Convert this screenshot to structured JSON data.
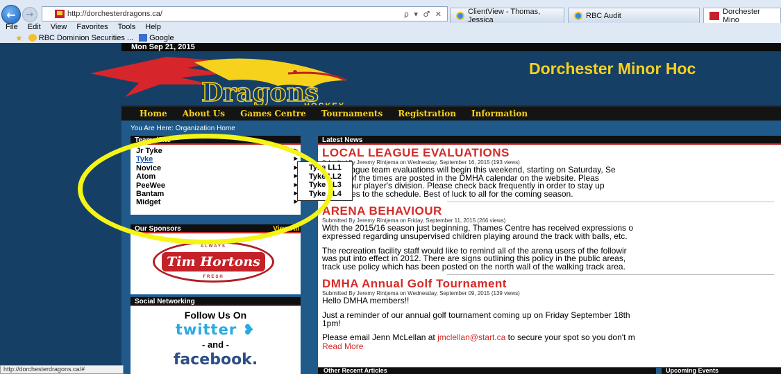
{
  "browser": {
    "url": "http://dorchesterdragons.ca/",
    "address_controls": "ρ ▾ ♂ ✕",
    "tabs": [
      {
        "label": "ClientView - Thomas, Jessica"
      },
      {
        "label": "RBC Audit"
      },
      {
        "label": "Dorchester Mino"
      }
    ],
    "menu": [
      "File",
      "Edit",
      "View",
      "Favorites",
      "Tools",
      "Help"
    ],
    "favorites": [
      "RBC Dominion Securities ...",
      "Google"
    ],
    "status_url": "http://dorchesterdragons.ca/#"
  },
  "page": {
    "date": "Mon Sep 21, 2015",
    "site_title": "Dorchester Minor Hoc",
    "logo_text": "Dragons",
    "logo_subtext": "HOCKEY",
    "nav": [
      "Home",
      "About Us",
      "Games Centre",
      "Tournaments",
      "Registration",
      "Information"
    ],
    "breadcrumb": "You Are Here: Organization Home",
    "teams": {
      "heading": "Teams/Site",
      "items": [
        "Jr Tyke",
        "Tyke",
        "Novice",
        "Atom",
        "PeeWee",
        "Bantam",
        "Midget"
      ],
      "submenu": [
        "Tyke LL1",
        "Tyke LL2",
        "Tyke LL3",
        "Tyke LL4"
      ]
    },
    "sponsors": {
      "heading": "Our Sponsors",
      "view_all": "View All",
      "sponsor_name": "Tim Hortons",
      "top_small": "ALWAYS",
      "bottom_small": "FRESH"
    },
    "social": {
      "heading": "Social Networking",
      "follow": "Follow Us On",
      "twitter": "twitter",
      "and": "- and -",
      "facebook": "facebook."
    },
    "news": {
      "heading": "Latest News",
      "articles": [
        {
          "title": "LOCAL LEAGUE EVALUATIONS",
          "meta": "Submitted By Jeremy Rintjema on Wednesday, September 16, 2015 (193 views)",
          "lines": [
            "Local league team evaluations will begin this weekend, starting on Saturday, Se",
            "am.  All of the times are posted in the DMHA calendar on the website.  Pleas",
            "es for your player's division.  Please check back frequently in order to stay up",
            "y changes to the schedule.  Best of luck to all for the coming season."
          ]
        },
        {
          "title": "ARENA BEHAVIOUR",
          "meta": "Submitted By Jeremy Rintjema on Friday, September 11, 2015 (266 views)",
          "lines": [
            "With the 2015/16 season just beginning, Thames Centre has received expressions o",
            "expressed regarding unsupervised children playing around the track with balls, etc.",
            "",
            "The recreation facility staff would like to remind all of the arena users of the followir",
            "was put into effect in 2012. There are signs outlining this policy in the public areas,",
            "track use policy which has been posted on the north wall of the walking track area."
          ]
        },
        {
          "title": "DMHA Annual Golf Tournament",
          "meta": "Submitted By Jeremy Rintjema on Wednesday, September 09, 2015 (139 views)",
          "lines": [
            "Hello DMHA members!!",
            "",
            "Just a reminder of our annual golf tournament coming up on Friday September 18th",
            "1pm!",
            ""
          ],
          "email_prefix": "Please email Jenn McLellan at ",
          "email": "jmclellan@start.ca",
          "email_suffix": " to secure your spot so you don't m",
          "read_more": "Read More"
        }
      ]
    },
    "other_recent_heading": "Other Recent Articles",
    "upcoming_heading": "Upcoming Events"
  },
  "colors": {
    "accent_yellow": "#f7d21d",
    "headline_red": "#d52a27",
    "page_blue": "#163f66",
    "annotation": "#f4f416"
  }
}
